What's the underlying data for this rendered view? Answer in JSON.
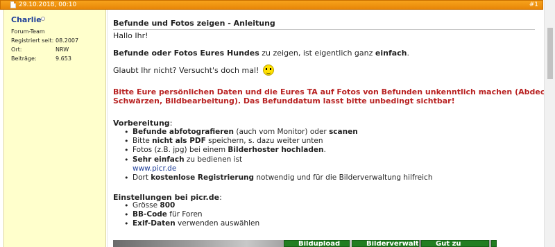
{
  "post": {
    "date": "29.10.2018, 00:10",
    "number": "#1"
  },
  "user": {
    "name": "Charlie",
    "rank": "Forum-Team",
    "registered_label": "Registriert seit:",
    "registered_value": "08.2007",
    "location_label": "Ort:",
    "location_value": "NRW",
    "posts_label": "Beiträge:",
    "posts_value": "9.653"
  },
  "content": {
    "title": "Befunde und Fotos zeigen - Anleitung",
    "greeting": "Hallo Ihr!",
    "intro_1": "Befunde oder Fotos Eures Hundes",
    "intro_2": " zu zeigen, ist eigentlich ganz ",
    "intro_3": "einfach",
    "intro_4": ".",
    "try_text": "Glaubt Ihr nicht? Versucht's doch mal!",
    "warning_1": "Bitte Eure persönlichen Daten und die Eures TA auf Fotos von Befunden unkenntlich machen (Abdecken,",
    "warning_2": "Schwärzen, Bildbearbeitung). Das Befunddatum lasst bitte unbedingt sichtbar!",
    "prep_heading": "Vorbereitung",
    "prep_colon": ":",
    "prep_items": [
      {
        "b1": "Befunde abfotografieren",
        "t1": " (auch vom Monitor) oder ",
        "b2": "scanen"
      },
      {
        "t1": "Bitte ",
        "b1": "nicht als PDF",
        "t2": " speichern, s. dazu weiter unten"
      },
      {
        "t1": "Fotos (z.B. jpg) bei einem ",
        "b1": "Bilderhoster hochladen",
        "t2": "."
      },
      {
        "b1": "Sehr einfach",
        "t1": " zu bedienen ist"
      },
      {
        "link": "www.picr.de"
      },
      {
        "t1": "Dort ",
        "b1": "kostenlose Registrierung",
        "t2": " notwendig und für die Bilderverwaltung hilfreich"
      }
    ],
    "settings_heading": "Einstellungen bei picr.de",
    "settings_colon": ":",
    "settings_items": [
      {
        "t1": "Grösse ",
        "b1": "800"
      },
      {
        "b1": "BB-Code",
        "t1": " für Foren"
      },
      {
        "b1": "Exif-Daten",
        "t1": " verwenden auswählen"
      }
    ],
    "buttons": [
      "Bildupload",
      "Bilderverwaltung",
      "Gut zu wissen"
    ]
  },
  "colors": {
    "header": "#e88708",
    "userinfo_bg": "#ffffcc",
    "username": "#1f3f99",
    "warning": "#b82222",
    "button": "#217e21"
  },
  "icons": {
    "document": "document-icon",
    "online": "online-status-icon",
    "smiley": "smiley-icon"
  }
}
